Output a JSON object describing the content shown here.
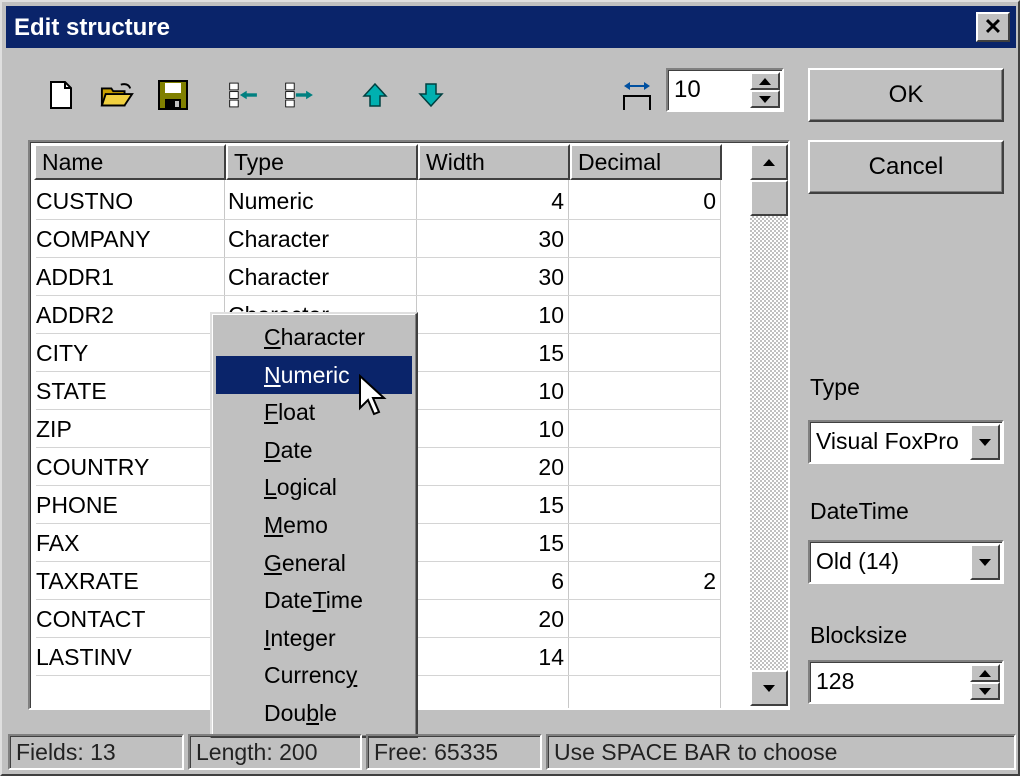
{
  "window": {
    "title": "Edit structure",
    "close_glyph": "✕"
  },
  "toolbar": {
    "icons": [
      "new-file-icon",
      "open-folder-icon",
      "save-disk-icon",
      "insert-field-icon",
      "delete-field-icon",
      "move-up-icon",
      "move-down-icon",
      "field-width-icon"
    ],
    "width_value": "10"
  },
  "buttons": {
    "ok": "OK",
    "cancel": "Cancel"
  },
  "grid": {
    "headers": [
      "Name",
      "Type",
      "Width",
      "Decimal"
    ],
    "rows": [
      {
        "name": "CUSTNO",
        "type": "Numeric",
        "width": "4",
        "decimal": "0"
      },
      {
        "name": "COMPANY",
        "type": "Character",
        "width": "30",
        "decimal": ""
      },
      {
        "name": "ADDR1",
        "type": "Character",
        "width": "30",
        "decimal": ""
      },
      {
        "name": "ADDR2",
        "type": "Character",
        "width": "10",
        "decimal": ""
      },
      {
        "name": "CITY",
        "type": "",
        "width": "15",
        "decimal": ""
      },
      {
        "name": "STATE",
        "type": "",
        "width": "10",
        "decimal": ""
      },
      {
        "name": "ZIP",
        "type": "",
        "width": "10",
        "decimal": ""
      },
      {
        "name": "COUNTRY",
        "type": "",
        "width": "20",
        "decimal": ""
      },
      {
        "name": "PHONE",
        "type": "",
        "width": "15",
        "decimal": ""
      },
      {
        "name": "FAX",
        "type": "",
        "width": "15",
        "decimal": ""
      },
      {
        "name": "TAXRATE",
        "type": "",
        "width": "6",
        "decimal": "2"
      },
      {
        "name": "CONTACT",
        "type": "",
        "width": "20",
        "decimal": ""
      },
      {
        "name": "LASTINV",
        "type": "",
        "width": "14",
        "decimal": ""
      }
    ]
  },
  "type_menu": {
    "items": [
      {
        "pre": "",
        "key": "C",
        "post": "haracter"
      },
      {
        "pre": "",
        "key": "N",
        "post": "umeric"
      },
      {
        "pre": "",
        "key": "F",
        "post": "loat"
      },
      {
        "pre": "",
        "key": "D",
        "post": "ate"
      },
      {
        "pre": "",
        "key": "L",
        "post": "ogical"
      },
      {
        "pre": "",
        "key": "M",
        "post": "emo"
      },
      {
        "pre": "",
        "key": "G",
        "post": "eneral"
      },
      {
        "pre": "Date",
        "key": "T",
        "post": "ime"
      },
      {
        "pre": "",
        "key": "I",
        "post": "nteger"
      },
      {
        "pre": "Currenc",
        "key": "y",
        "post": ""
      },
      {
        "pre": "Dou",
        "key": "b",
        "post": "le"
      }
    ],
    "selected": "Numeric"
  },
  "side": {
    "type_label": "Type",
    "type_value": "Visual FoxPro",
    "datetime_label": "DateTime",
    "datetime_value": "Old (14)",
    "blocksize_label": "Blocksize",
    "blocksize_value": "128"
  },
  "status": {
    "fields": "Fields: 13",
    "length": "Length: 200",
    "free": "Free: 65335",
    "hint": "Use SPACE BAR to choose"
  },
  "colors": {
    "titlebar": "#0a246a",
    "face": "#c0c0c0",
    "highlight": "#0a246a",
    "arrow_teal": "#00a0a0"
  }
}
